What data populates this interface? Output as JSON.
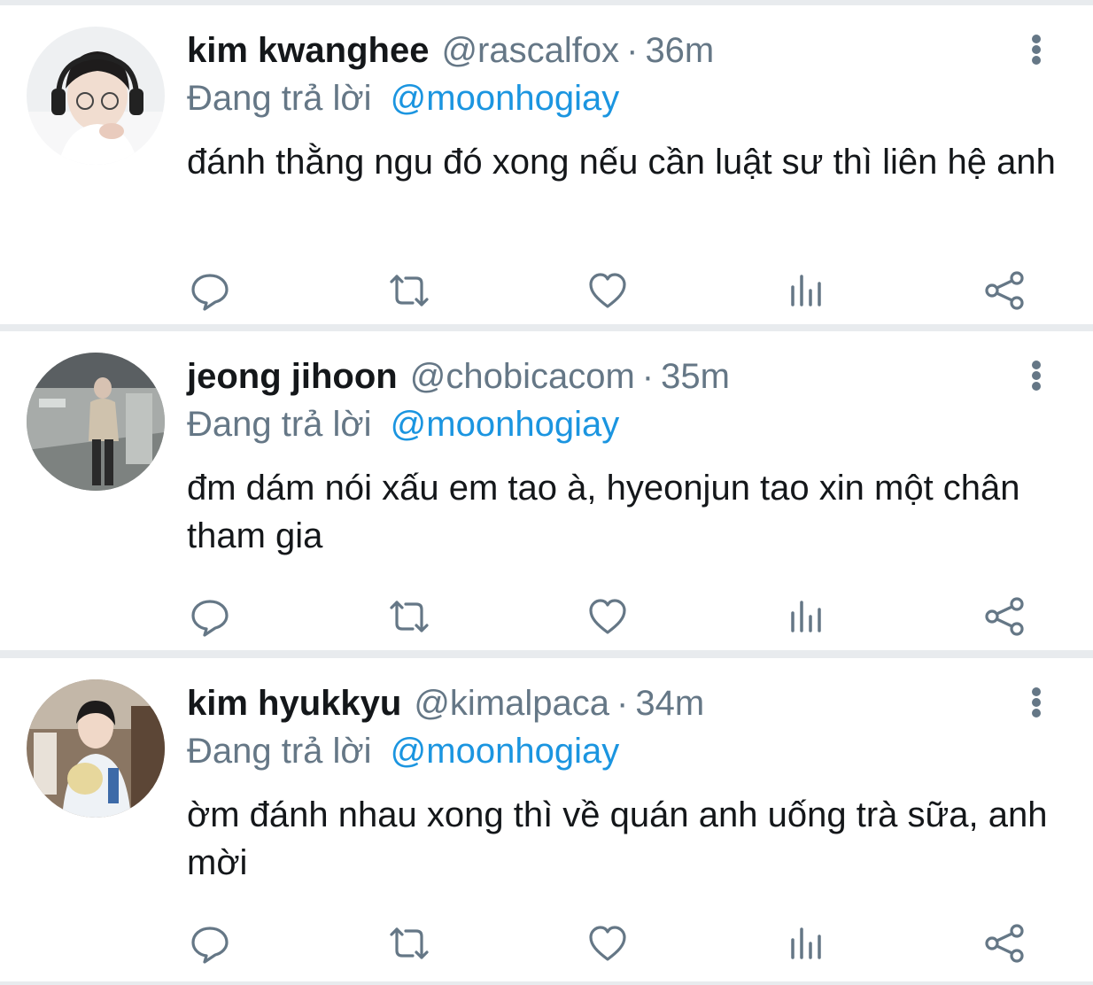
{
  "tweets": [
    {
      "display_name": "kim kwanghee",
      "handle": "@rascalfox",
      "separator": "·",
      "time": "36m",
      "reply_prefix": "Đang trả lời",
      "reply_to": "@moonhogiay",
      "text": "đánh thằng ngu đó xong nếu cần luật sư thì liên hệ anh"
    },
    {
      "display_name": "jeong jihoon",
      "handle": "@chobicacom",
      "separator": "·",
      "time": "35m",
      "reply_prefix": "Đang trả lời",
      "reply_to": "@moonhogiay",
      "text": "đm dám nói xấu em tao à, hyeonjun tao xin một chân tham gia"
    },
    {
      "display_name": "kim hyukkyu",
      "handle": "@kimalpaca",
      "separator": "·",
      "time": "34m",
      "reply_prefix": "Đang trả lời",
      "reply_to": "@moonhogiay",
      "text": "ờm đánh nhau xong thì về quán anh uống trà sữa, anh mời"
    }
  ],
  "icons": {
    "more": "more-vertical-icon",
    "reply": "reply-icon",
    "retweet": "retweet-icon",
    "like": "like-icon",
    "stats": "stats-icon",
    "share": "share-icon"
  },
  "colors": {
    "background": "#ffffff",
    "separator": "#e8ebee",
    "text_primary": "#14171a",
    "text_secondary": "#657786",
    "mention": "#1b95e0",
    "icon": "#657786"
  }
}
